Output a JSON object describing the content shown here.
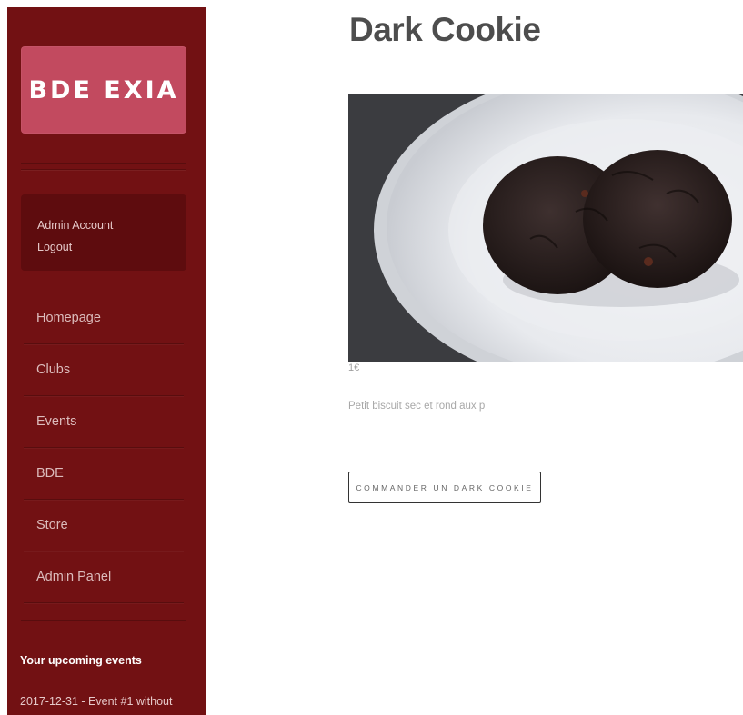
{
  "sidebar": {
    "logo_text": "BDE EXIA",
    "account": {
      "admin_account_label": "Admin Account",
      "logout_label": "Logout"
    },
    "nav_items": [
      {
        "label": "Homepage"
      },
      {
        "label": "Clubs"
      },
      {
        "label": "Events"
      },
      {
        "label": "BDE"
      },
      {
        "label": "Store"
      },
      {
        "label": "Admin Panel"
      }
    ],
    "upcoming_events": {
      "title": "Your upcoming events",
      "items": [
        "2017-12-31 - Event #1 without"
      ]
    }
  },
  "product": {
    "title": "Dark Cookie",
    "price": "1€",
    "description": "Petit biscuit sec et rond aux p",
    "order_button_label": "COMMANDER UN DARK COOKIE"
  },
  "colors": {
    "sidebar_bg": "#721113",
    "logo_bg": "#c24a5f",
    "account_box_bg": "#5e0c0e",
    "title_text": "#4d4d4d"
  }
}
